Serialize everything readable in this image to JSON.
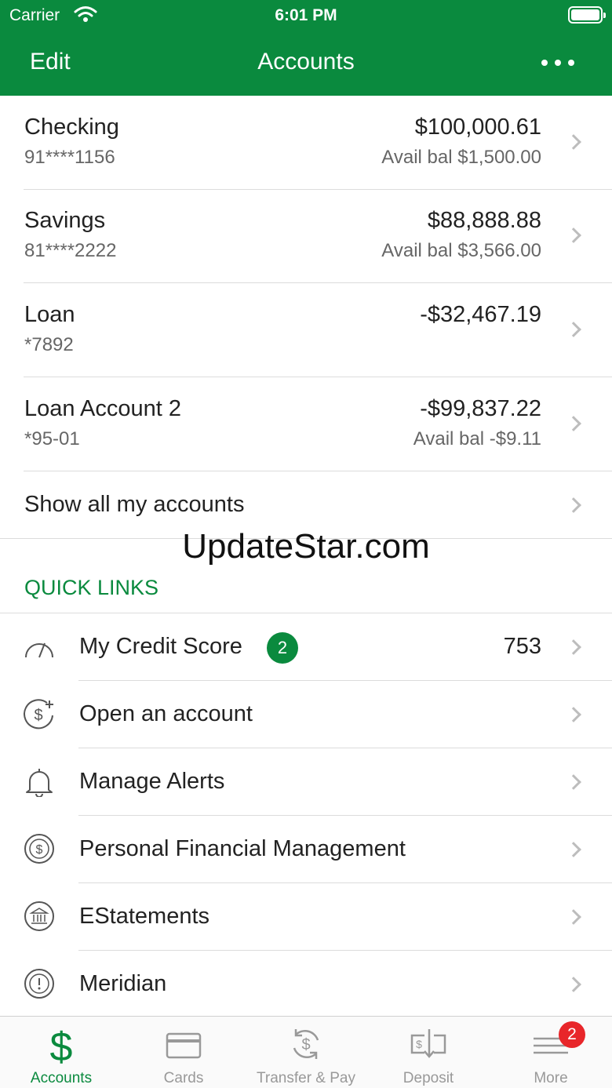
{
  "status_bar": {
    "carrier": "Carrier",
    "time": "6:01 PM"
  },
  "nav": {
    "edit_label": "Edit",
    "title": "Accounts",
    "more_icon": "ellipsis-icon"
  },
  "accounts": [
    {
      "name": "Checking",
      "number": "91****1156",
      "balance": "$100,000.61",
      "available": "Avail bal $1,500.00"
    },
    {
      "name": "Savings",
      "number": "81****2222",
      "balance": "$88,888.88",
      "available": "Avail bal $3,566.00"
    },
    {
      "name": "Loan",
      "number": "*7892",
      "balance": "-$32,467.19",
      "available": ""
    },
    {
      "name": "Loan Account 2",
      "number": "*95-01",
      "balance": "-$99,837.22",
      "available": "Avail bal -$9.11"
    }
  ],
  "show_all_label": "Show all my accounts",
  "watermark": "UpdateStar.com",
  "quick_links": {
    "header": "QUICK LINKS",
    "items": [
      {
        "label": "My Credit Score",
        "icon": "speedometer-icon",
        "badge": "2",
        "value": "753"
      },
      {
        "label": "Open an account",
        "icon": "dollar-plus-icon",
        "badge": "",
        "value": ""
      },
      {
        "label": "Manage Alerts",
        "icon": "bell-icon",
        "badge": "",
        "value": ""
      },
      {
        "label": "Personal Financial Management",
        "icon": "dollar-circle-icon",
        "badge": "",
        "value": ""
      },
      {
        "label": "EStatements",
        "icon": "bank-icon",
        "badge": "",
        "value": ""
      },
      {
        "label": "Meridian",
        "icon": "info-circle-icon",
        "badge": "",
        "value": ""
      }
    ]
  },
  "tabs": [
    {
      "label": "Accounts",
      "icon": "dollar-icon",
      "active": true
    },
    {
      "label": "Cards",
      "icon": "card-icon",
      "active": false
    },
    {
      "label": "Transfer & Pay",
      "icon": "transfer-icon",
      "active": false
    },
    {
      "label": "Deposit",
      "icon": "check-deposit-icon",
      "active": false
    },
    {
      "label": "More",
      "icon": "menu-icon",
      "active": false,
      "badge": "2"
    }
  ],
  "colors": {
    "brand": "#0a8a3e",
    "badge_red": "#e8262a"
  }
}
